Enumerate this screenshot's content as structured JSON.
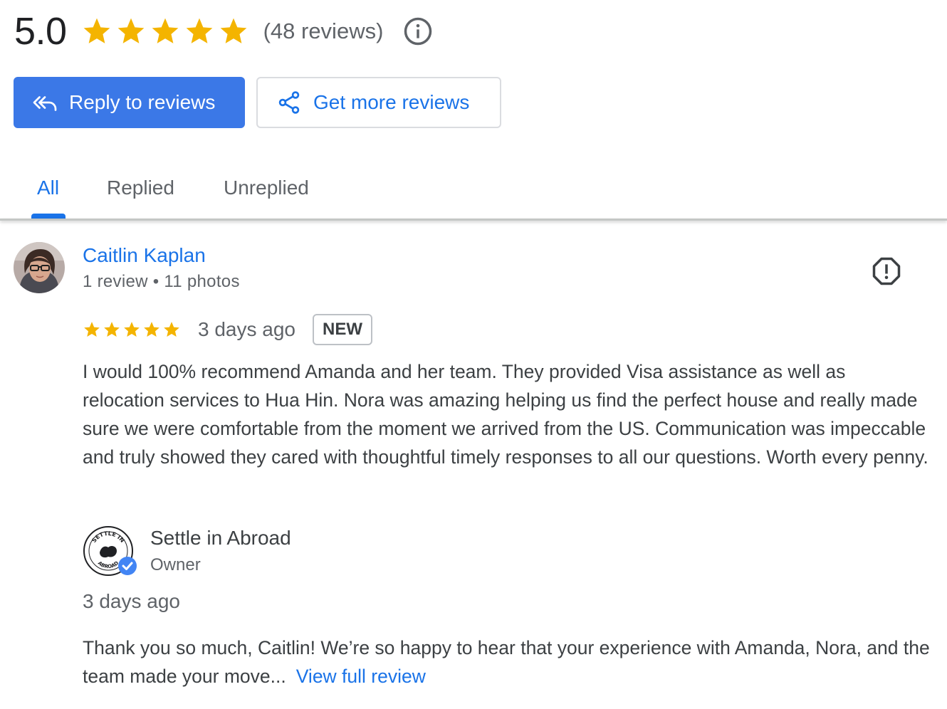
{
  "summary": {
    "rating": "5.0",
    "stars": 5,
    "review_count": "(48 reviews)",
    "info_icon": "info-icon"
  },
  "actions": {
    "reply_label": "Reply to reviews",
    "reply_icon": "reply-all-icon",
    "get_more_label": "Get more reviews",
    "get_more_icon": "share-icon"
  },
  "tabs": [
    {
      "label": "All",
      "active": true
    },
    {
      "label": "Replied",
      "active": false
    },
    {
      "label": "Unreplied",
      "active": false
    }
  ],
  "review": {
    "reviewer_name": "Caitlin Kaplan",
    "reviewer_meta": "1 review • 11 photos",
    "stars": 5,
    "date": "3 days ago",
    "badge": "NEW",
    "text": "I would 100% recommend Amanda and her team. They provided Visa assistance as well as relocation services to Hua Hin. Nora was amazing helping us find the perfect house and really made sure we were comfortable from the moment we arrived from the US. Communication was impeccable and truly showed they cared with thoughtful timely responses to all our questions. Worth every penny.",
    "flag_icon": "report-icon"
  },
  "reply": {
    "owner_name": "Settle in Abroad",
    "owner_role": "Owner",
    "logo_text_top": "SETTLE IN",
    "logo_text_bottom": "ABROAD",
    "date": "3 days ago",
    "text": "Thank you so much, Caitlin! We’re so happy to hear that your experience with Amanda, Nora, and the team made your move...",
    "view_full_label": "View full review"
  },
  "colors": {
    "accent": "#1a73e8",
    "primary_button": "#3b78e7",
    "star": "#f4b400",
    "verified": "#4285f4"
  }
}
